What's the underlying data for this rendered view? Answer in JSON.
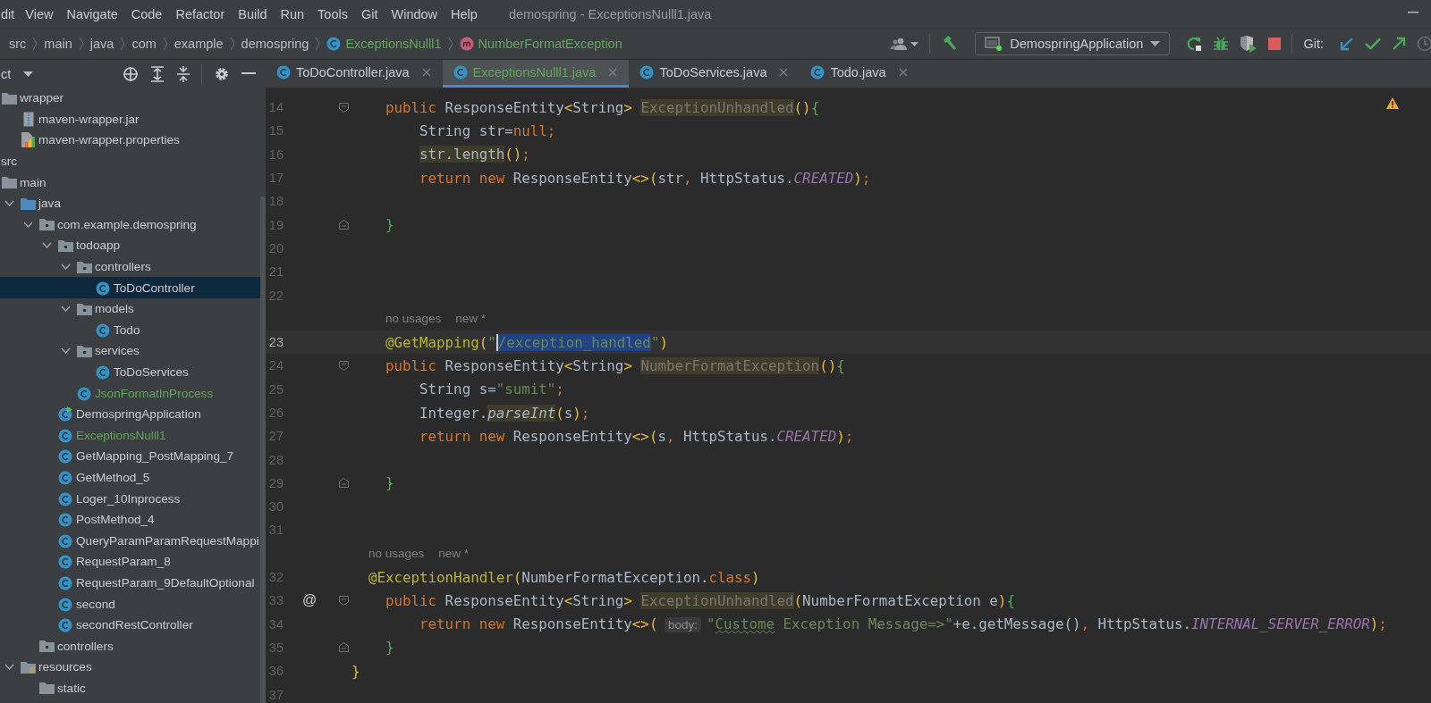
{
  "menu": [
    "dit",
    "View",
    "Navigate",
    "Code",
    "Refactor",
    "Build",
    "Run",
    "Tools",
    "Git",
    "Window",
    "Help"
  ],
  "window": {
    "title": "demospring - ExceptionsNulll1.java"
  },
  "breadcrumbs": [
    {
      "label": "src",
      "kind": "dir",
      "added": false
    },
    {
      "label": "main",
      "kind": "dir",
      "added": false
    },
    {
      "label": "java",
      "kind": "dir",
      "added": false
    },
    {
      "label": "com",
      "kind": "dir",
      "added": false
    },
    {
      "label": "example",
      "kind": "dir",
      "added": false
    },
    {
      "label": "demospring",
      "kind": "dir",
      "added": false
    },
    {
      "label": "ExceptionsNulll1",
      "kind": "class",
      "added": true
    },
    {
      "label": "NumberFormatException",
      "kind": "method",
      "added": true
    }
  ],
  "toolbar": {
    "run_config": "DemospringApplication",
    "git_label": "Git:"
  },
  "project_tree": {
    "header": "ct",
    "above": [
      {
        "label": "wrapper",
        "kind": "folder",
        "selected": false,
        "added": false,
        "children": [
          {
            "label": "maven-wrapper.jar",
            "kind": "jar",
            "selected": false,
            "added": false
          },
          {
            "label": "maven-wrapper.properties",
            "kind": "properties",
            "selected": false,
            "added": false
          }
        ]
      }
    ],
    "items": [
      {
        "label": "src",
        "selected": false,
        "added": false,
        "children": [
          {
            "label": "main",
            "kind": "folder",
            "selected": false,
            "added": false,
            "children": [
              {
                "label": "java",
                "kind": "source-root",
                "expanded": true,
                "selected": false,
                "added": false,
                "children": [
                  {
                    "label": "com.example.demospring",
                    "kind": "package",
                    "expanded": true,
                    "selected": false,
                    "added": false,
                    "children": [
                      {
                        "label": "todoapp",
                        "kind": "package",
                        "expanded": true,
                        "selected": false,
                        "added": false,
                        "children": [
                          {
                            "label": "controllers",
                            "kind": "package",
                            "expanded": true,
                            "selected": false,
                            "added": false,
                            "children": [
                              {
                                "label": "ToDoController",
                                "kind": "class",
                                "selected": true,
                                "added": false
                              }
                            ]
                          },
                          {
                            "label": "models",
                            "kind": "package",
                            "expanded": true,
                            "selected": false,
                            "added": false,
                            "children": [
                              {
                                "label": "Todo",
                                "kind": "class",
                                "selected": false,
                                "added": false
                              }
                            ]
                          },
                          {
                            "label": "services",
                            "kind": "package",
                            "expanded": true,
                            "selected": false,
                            "added": false,
                            "children": [
                              {
                                "label": "ToDoServices",
                                "kind": "class",
                                "selected": false,
                                "added": false
                              }
                            ]
                          },
                          {
                            "label": "JsonFormatInProcess",
                            "kind": "class",
                            "selected": false,
                            "added": true
                          }
                        ]
                      },
                      {
                        "label": "DemospringApplication",
                        "kind": "app-class",
                        "selected": false,
                        "added": false
                      },
                      {
                        "label": "ExceptionsNulll1",
                        "kind": "class",
                        "selected": false,
                        "added": true
                      },
                      {
                        "label": "GetMapping_PostMapping_7",
                        "kind": "class",
                        "selected": false,
                        "added": false
                      },
                      {
                        "label": "GetMethod_5",
                        "kind": "class",
                        "selected": false,
                        "added": false
                      },
                      {
                        "label": "Loger_10Inprocess",
                        "kind": "class",
                        "selected": false,
                        "added": false
                      },
                      {
                        "label": "PostMethod_4",
                        "kind": "class",
                        "selected": false,
                        "added": false
                      },
                      {
                        "label": "QueryParamParamRequestMappi",
                        "kind": "class",
                        "selected": false,
                        "added": false
                      },
                      {
                        "label": "RequestParam_8",
                        "kind": "class",
                        "selected": false,
                        "added": false
                      },
                      {
                        "label": "RequestParam_9DefaultOptional",
                        "kind": "class",
                        "selected": false,
                        "added": false
                      },
                      {
                        "label": "second",
                        "kind": "class",
                        "selected": false,
                        "added": false
                      },
                      {
                        "label": "secondRestController",
                        "kind": "class",
                        "selected": false,
                        "added": false
                      }
                    ]
                  },
                  {
                    "label": "controllers",
                    "kind": "package",
                    "selected": false,
                    "added": false
                  }
                ]
              },
              {
                "label": "resources",
                "kind": "resources-root",
                "expanded": true,
                "selected": false,
                "added": false,
                "children": [
                  {
                    "label": "static",
                    "kind": "folder",
                    "selected": false,
                    "added": false
                  }
                ]
              }
            ]
          }
        ]
      }
    ]
  },
  "tabs": [
    {
      "label": "ToDoController.java",
      "selected": false,
      "added": false
    },
    {
      "label": "ExceptionsNulll1.java",
      "selected": true,
      "added": true
    },
    {
      "label": "ToDoServices.java",
      "selected": false,
      "added": false
    },
    {
      "label": "Todo.java",
      "selected": false,
      "added": false
    }
  ],
  "editor": {
    "lines": [
      {
        "num": "14",
        "kind": "member",
        "current": false,
        "fold_start": true,
        "fold_end": false,
        "tokens": [
          {
            "t": "public",
            "kind": "kw"
          },
          {
            "t": " ResponseEntity",
            "kind": "txt"
          },
          {
            "t": "<",
            "kind": "paren"
          },
          {
            "t": "String",
            "kind": "txt"
          },
          {
            "t": ">",
            "kind": "paren"
          },
          {
            "t": "ExceptionUnhandled",
            "kind": "unused"
          },
          {
            "t": "()",
            "kind": "paren"
          },
          {
            "t": "{",
            "kind": "brace"
          }
        ]
      },
      {
        "num": "15",
        "kind": "body",
        "current": false,
        "fold_start": false,
        "fold_end": false,
        "tokens": [
          {
            "t": "String str=",
            "kind": "txt"
          },
          {
            "t": "null;",
            "kind": "kw"
          }
        ]
      },
      {
        "num": "16",
        "kind": "body",
        "current": false,
        "fold_start": false,
        "fold_end": false,
        "tokens": [
          {
            "t": "str.length",
            "kind": "hl"
          },
          {
            "t": "()",
            "kind": "paren"
          },
          {
            "t": ";",
            "kind": "kw"
          }
        ]
      },
      {
        "num": "17",
        "kind": "body",
        "current": false,
        "fold_start": false,
        "fold_end": false,
        "tokens": [
          {
            "t": "return new",
            "kind": "kw"
          },
          {
            "t": " ResponseEntity",
            "kind": "txt"
          },
          {
            "t": "<>(",
            "kind": "paren"
          },
          {
            "t": "str",
            "kind": "txt"
          },
          {
            "t": ",",
            "kind": "kw"
          },
          {
            "t": " HttpStatus.",
            "kind": "txt"
          },
          {
            "t": "CREATED",
            "kind": "const"
          },
          {
            "t": ")",
            "kind": "paren"
          },
          {
            "t": ";",
            "kind": "kw"
          }
        ]
      },
      {
        "num": "18",
        "kind": "blank",
        "current": false,
        "fold_start": false,
        "fold_end": false
      },
      {
        "num": "19",
        "kind": "member",
        "current": false,
        "fold_start": false,
        "fold_end": true,
        "tokens": [
          {
            "t": "}",
            "kind": "brace"
          }
        ]
      },
      {
        "num": "20",
        "kind": "blank",
        "current": false,
        "fold_start": false,
        "fold_end": false
      },
      {
        "num": "21",
        "kind": "blank",
        "current": false,
        "fold_start": false,
        "fold_end": false
      },
      {
        "num": "22",
        "kind": "blank",
        "current": false,
        "fold_start": false,
        "fold_end": false
      },
      {
        "num": "23",
        "kind": "member",
        "current": true,
        "fold_start": false,
        "fold_end": false,
        "hints": [
          "no usages",
          "new *"
        ],
        "tokens": [
          {
            "t": "@GetMapping",
            "kind": "ann"
          },
          {
            "t": "(",
            "kind": "paren"
          },
          {
            "t": "\"",
            "kind": "str"
          },
          {
            "t": "/exception_handled",
            "kind": "sel"
          },
          {
            "t": "\"",
            "kind": "str"
          },
          {
            "t": ")",
            "kind": "paren"
          }
        ]
      },
      {
        "num": "24",
        "kind": "member",
        "current": false,
        "fold_start": true,
        "fold_end": false,
        "tokens": [
          {
            "t": "public",
            "kind": "kw"
          },
          {
            "t": " ResponseEntity",
            "kind": "txt"
          },
          {
            "t": "<",
            "kind": "paren"
          },
          {
            "t": "String",
            "kind": "txt"
          },
          {
            "t": ">",
            "kind": "paren"
          },
          {
            "t": "NumberFormatException",
            "kind": "unused"
          },
          {
            "t": "()",
            "kind": "paren"
          },
          {
            "t": "{",
            "kind": "brace"
          }
        ]
      },
      {
        "num": "25",
        "kind": "body",
        "current": false,
        "fold_start": false,
        "fold_end": false,
        "tokens": [
          {
            "t": "String s=",
            "kind": "txt"
          },
          {
            "t": "\"sumit\"",
            "kind": "str"
          },
          {
            "t": ";",
            "kind": "kw"
          }
        ]
      },
      {
        "num": "26",
        "kind": "body",
        "current": false,
        "fold_start": false,
        "fold_end": false,
        "tokens": [
          {
            "t": "Integer.",
            "kind": "txt"
          },
          {
            "t": "parseInt",
            "kind": "hli"
          },
          {
            "t": "(",
            "kind": "paren"
          },
          {
            "t": "s",
            "kind": "txt"
          },
          {
            "t": ")",
            "kind": "paren"
          },
          {
            "t": ";",
            "kind": "kw"
          }
        ]
      },
      {
        "num": "27",
        "kind": "body",
        "current": false,
        "fold_start": false,
        "fold_end": false,
        "tokens": [
          {
            "t": "return new",
            "kind": "kw"
          },
          {
            "t": " ResponseEntity",
            "kind": "txt"
          },
          {
            "t": "<>(",
            "kind": "paren"
          },
          {
            "t": "s",
            "kind": "txt"
          },
          {
            "t": ",",
            "kind": "kw"
          },
          {
            "t": " HttpStatus.",
            "kind": "txt"
          },
          {
            "t": "CREATED",
            "kind": "const"
          },
          {
            "t": ")",
            "kind": "paren"
          },
          {
            "t": ";",
            "kind": "kw"
          }
        ]
      },
      {
        "num": "28",
        "kind": "blank",
        "current": false,
        "fold_start": false,
        "fold_end": false
      },
      {
        "num": "29",
        "kind": "member",
        "current": false,
        "fold_start": false,
        "fold_end": true,
        "tokens": [
          {
            "t": "}",
            "kind": "brace"
          }
        ]
      },
      {
        "num": "30",
        "kind": "blank",
        "current": false,
        "fold_start": false,
        "fold_end": false
      },
      {
        "num": "31",
        "kind": "blank",
        "current": false,
        "fold_start": false,
        "fold_end": false
      },
      {
        "num": "32",
        "kind": "half",
        "current": false,
        "fold_start": false,
        "fold_end": false,
        "hints": [
          "no usages",
          "new *"
        ],
        "tokens": [
          {
            "t": "@ExceptionHandler",
            "kind": "ann"
          },
          {
            "t": "(",
            "kind": "paren"
          },
          {
            "t": "NumberFormatException.",
            "kind": "txt"
          },
          {
            "t": "class",
            "kind": "kw"
          },
          {
            "t": ")",
            "kind": "paren"
          }
        ]
      },
      {
        "num": "33",
        "kind": "member",
        "current": false,
        "fold_start": true,
        "fold_end": false,
        "gutter_mark": "@",
        "tokens": [
          {
            "t": "public",
            "kind": "kw"
          },
          {
            "t": " ResponseEntity",
            "kind": "txt"
          },
          {
            "t": "<",
            "kind": "paren"
          },
          {
            "t": "String",
            "kind": "txt"
          },
          {
            "t": ">",
            "kind": "paren"
          },
          {
            "t": "ExceptionUnhandled",
            "kind": "unused"
          },
          {
            "t": "(",
            "kind": "paren"
          },
          {
            "t": "NumberFormatException e",
            "kind": "txt"
          },
          {
            "t": ")",
            "kind": "paren"
          },
          {
            "t": "{",
            "kind": "brace"
          }
        ]
      },
      {
        "num": "34",
        "kind": "body",
        "current": false,
        "fold_start": false,
        "fold_end": false,
        "tokens": [
          {
            "t": "return new",
            "kind": "kw"
          },
          {
            "t": " ResponseEntity",
            "kind": "txt"
          },
          {
            "t": "<>(",
            "kind": "paren"
          },
          {
            "t": "body:",
            "kind": "hint"
          },
          {
            "t": "\"",
            "kind": "str"
          },
          {
            "t": "Custome",
            "kind": "typo"
          },
          {
            "t": " Exception Message=>\"",
            "kind": "str"
          },
          {
            "t": "+e.getMessage()",
            "kind": "txt"
          },
          {
            "t": ",",
            "kind": "kw"
          },
          {
            "t": " HttpStatus.",
            "kind": "txt"
          },
          {
            "t": "INTERNAL_SERVER_ERROR",
            "kind": "const"
          },
          {
            "t": ")",
            "kind": "paren"
          },
          {
            "t": ";",
            "kind": "kw"
          }
        ]
      },
      {
        "num": "35",
        "kind": "member",
        "current": false,
        "fold_start": false,
        "fold_end": true,
        "tokens": [
          {
            "t": "}",
            "kind": "brace"
          }
        ]
      },
      {
        "num": "36",
        "kind": "top",
        "current": false,
        "fold_start": false,
        "fold_end": false,
        "tokens": [
          {
            "t": "}",
            "kind": "paren"
          }
        ]
      },
      {
        "num": "37",
        "kind": "blank",
        "current": false,
        "fold_start": false,
        "fold_end": false
      }
    ]
  }
}
